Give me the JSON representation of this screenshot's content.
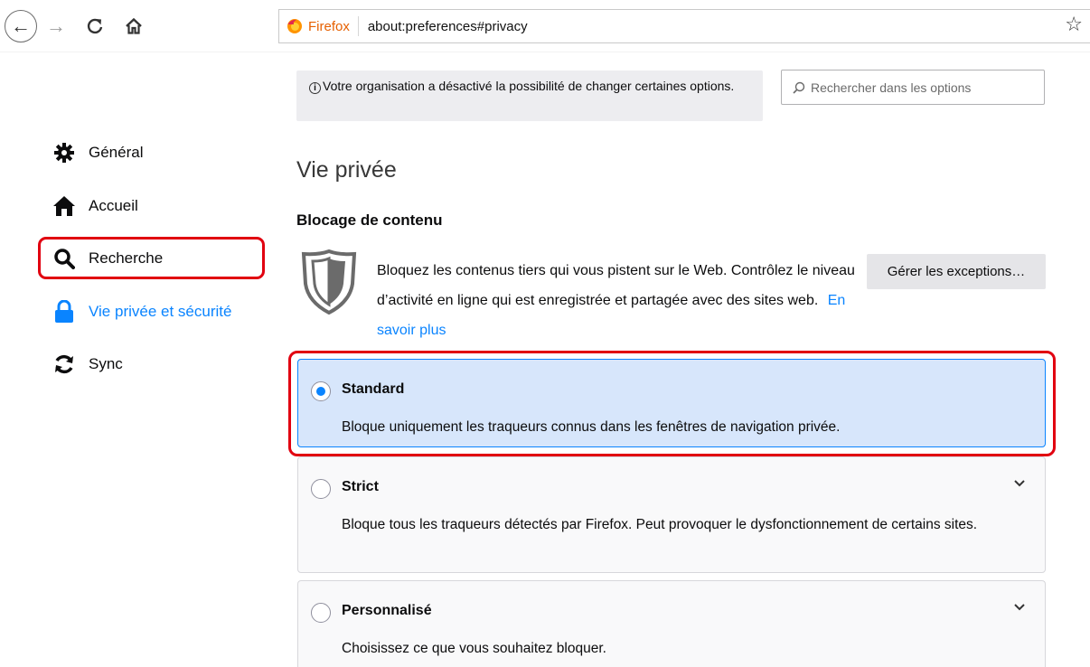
{
  "toolbar": {
    "back_glyph": "←",
    "forward_glyph": "→",
    "reload_icon": "reload-icon",
    "home_icon": "home-icon",
    "identity_label": "Firefox",
    "url": "about:preferences#privacy",
    "star_glyph": "☆"
  },
  "sidebar": {
    "items": [
      {
        "label": "Général",
        "icon": "gear-icon"
      },
      {
        "label": "Accueil",
        "icon": "home-icon"
      },
      {
        "label": "Recherche",
        "icon": "search-icon"
      },
      {
        "label": "Vie privée et sécurité",
        "icon": "lock-icon",
        "selected": true
      },
      {
        "label": "Sync",
        "icon": "sync-icon"
      }
    ]
  },
  "notice": {
    "text": "Votre organisation a désactivé la possibilité de changer certaines options."
  },
  "search": {
    "placeholder": "Rechercher dans les options"
  },
  "main": {
    "title": "Vie privée",
    "section_title": "Blocage de contenu",
    "description": "Bloquez les contenus tiers qui vous pistent sur le Web. Contrôlez le niveau d’activité en ligne qui est enregistrée et partagée avec des sites web.",
    "learn_more": "En savoir plus",
    "exceptions_button": "Gérer les exceptions…"
  },
  "options": [
    {
      "title": "Standard",
      "description": "Bloque uniquement les traqueurs connus dans les fenêtres de navigation privée.",
      "checked": true
    },
    {
      "title": "Strict",
      "description": "Bloque tous les traqueurs détectés par Firefox. Peut provoquer le dysfonctionnement de certains sites.",
      "checked": false
    },
    {
      "title": "Personnalisé",
      "description": "Choisissez ce que vous souhaitez bloquer.",
      "checked": false
    }
  ],
  "colors": {
    "accent": "#0a84ff",
    "highlight": "#e10010",
    "selected_bg": "#d7e6fb",
    "firefox_orange": "#e66000"
  }
}
